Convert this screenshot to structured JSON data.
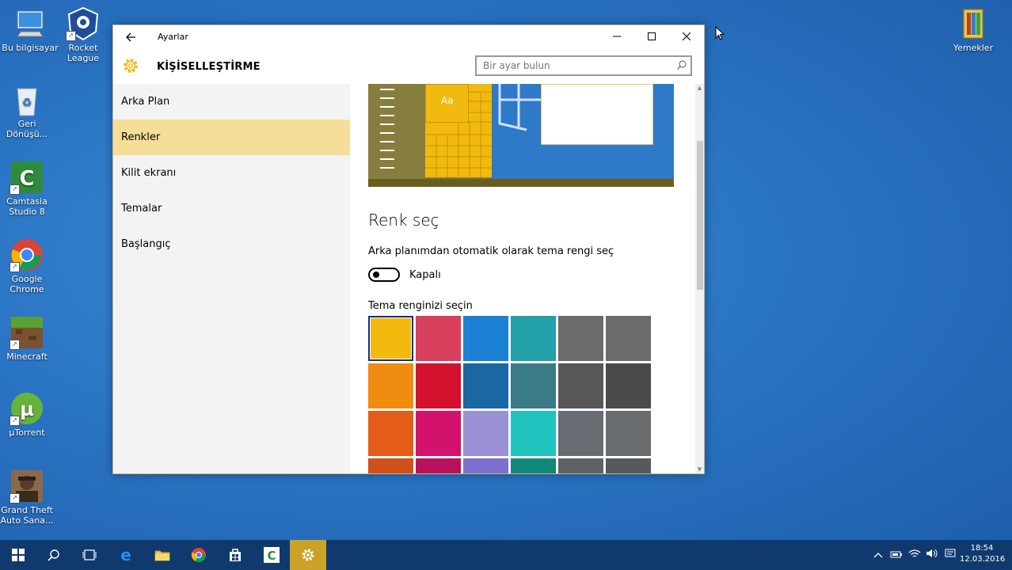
{
  "desktop": {
    "icons": [
      {
        "label": "Bu bilgisayar"
      },
      {
        "label": "Rocket League"
      },
      {
        "label": "Geri Dönüşü..."
      },
      {
        "label": "Camtasia Studio 8"
      },
      {
        "label": "Google Chrome"
      },
      {
        "label": "Minecraft"
      },
      {
        "label": "µTorrent"
      },
      {
        "label": "Grand Theft Auto Sana..."
      },
      {
        "label": "Yemekler"
      }
    ]
  },
  "window": {
    "title": "Ayarlar",
    "section_title": "KİŞİSELLEŞTİRME",
    "search": {
      "placeholder": "Bir ayar bulun"
    },
    "nav": {
      "items": [
        {
          "label": "Arka Plan",
          "active": false
        },
        {
          "label": "Renkler",
          "active": true
        },
        {
          "label": "Kilit ekranı",
          "active": false
        },
        {
          "label": "Temalar",
          "active": false
        },
        {
          "label": "Başlangıç",
          "active": false
        }
      ]
    },
    "content": {
      "preview_text": "Aa",
      "heading": "Renk seç",
      "auto_label": "Arka planımdan otomatik olarak tema rengi seç",
      "toggle_state": "Kapalı",
      "pick_label": "Tema renginizi seçin",
      "swatch_rows": [
        [
          "#f2b90f",
          "#d9405d",
          "#1a80d4",
          "#21a0a8",
          "#6b6b6b",
          "#6b6b6b"
        ],
        [
          "#f08c10",
          "#d4112e",
          "#1a67a3",
          "#3b7a87",
          "#575757",
          "#4a4a4a"
        ],
        [
          "#e55b1a",
          "#d3126e",
          "#9a90d6",
          "#21c3be",
          "#676c73",
          "#6a6d70"
        ],
        [
          "#d0501a",
          "#b8125e",
          "#7d6fd0",
          "#11887a",
          "#5d6266",
          "#55595c"
        ]
      ],
      "selected_swatch": "#f2b90f"
    }
  },
  "taskbar": {
    "time": "18:54",
    "date": "12.03.2016"
  },
  "colors": {
    "accent": "#f2b90f",
    "nav_active_bg": "#f5de97",
    "taskbar_active": "#c9a227"
  }
}
